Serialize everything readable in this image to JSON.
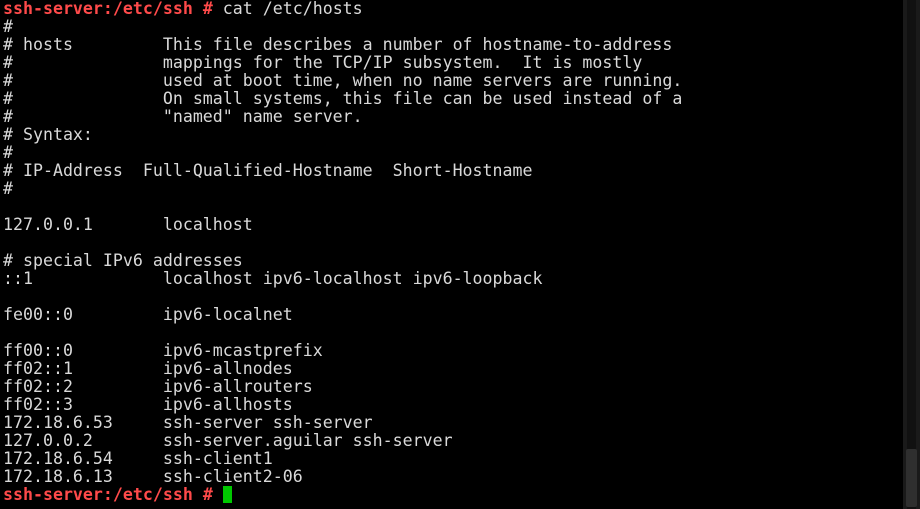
{
  "terminal": {
    "prompt": "ssh-server:/etc/ssh",
    "prompt_symbol": " #",
    "command": " cat /etc/hosts",
    "lines": [
      "#",
      "# hosts         This file describes a number of hostname-to-address",
      "#               mappings for the TCP/IP subsystem.  It is mostly",
      "#               used at boot time, when no name servers are running.",
      "#               On small systems, this file can be used instead of a",
      "#               \"named\" name server.",
      "# Syntax:",
      "#",
      "# IP-Address  Full-Qualified-Hostname  Short-Hostname",
      "#",
      "",
      "127.0.0.1       localhost",
      "",
      "# special IPv6 addresses",
      "::1             localhost ipv6-localhost ipv6-loopback",
      "",
      "fe00::0         ipv6-localnet",
      "",
      "ff00::0         ipv6-mcastprefix",
      "ff02::1         ipv6-allnodes",
      "ff02::2         ipv6-allrouters",
      "ff02::3         ipv6-allhosts",
      "172.18.6.53     ssh-server ssh-server",
      "127.0.0.2       ssh-server.aguilar ssh-server",
      "172.18.6.54     ssh-client1",
      "172.18.6.13     ssh-client2-06"
    ],
    "final_prompt": "ssh-server:/etc/ssh",
    "final_prompt_symbol": " # ",
    "colors": {
      "background": "#000000",
      "text": "#d9d9d9",
      "prompt": "#ff4a4a",
      "cursor": "#00c800"
    }
  }
}
